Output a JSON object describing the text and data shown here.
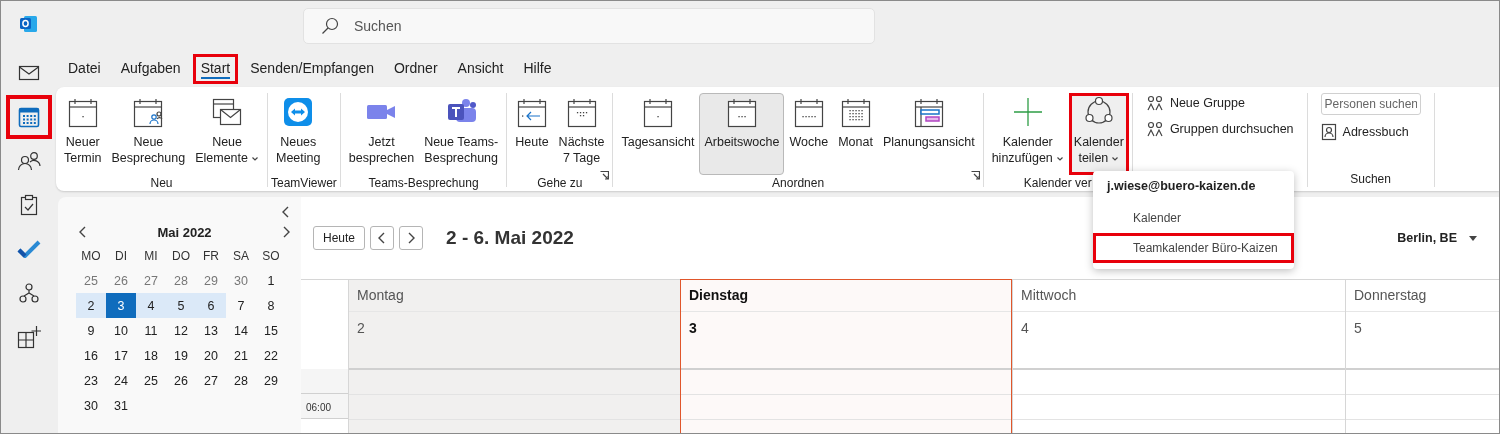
{
  "search": {
    "placeholder": "Suchen"
  },
  "rail": [
    {
      "selected": false,
      "highlighted": false
    },
    {
      "selected": true,
      "highlighted": true
    },
    {
      "selected": false,
      "highlighted": false
    },
    {
      "selected": false,
      "highlighted": false
    },
    {
      "selected": false,
      "highlighted": false
    },
    {
      "selected": false,
      "highlighted": false
    },
    {
      "selected": false,
      "highlighted": false
    }
  ],
  "tabs": [
    {
      "label": "Datei",
      "selected": false,
      "highlighted": false
    },
    {
      "label": "Aufgaben",
      "selected": false,
      "highlighted": false
    },
    {
      "label": "Start",
      "selected": true,
      "highlighted": true
    },
    {
      "label": "Senden/Empfangen",
      "selected": false,
      "highlighted": false
    },
    {
      "label": "Ordner",
      "selected": false,
      "highlighted": false
    },
    {
      "label": "Ansicht",
      "selected": false,
      "highlighted": false
    },
    {
      "label": "Hilfe",
      "selected": false,
      "highlighted": false
    }
  ],
  "ribbon": {
    "groups": [
      {
        "label": "Neu",
        "buttons": [
          {
            "kind": "large",
            "label": "Neuer\nTermin",
            "selected": false,
            "highlighted": false
          },
          {
            "kind": "large",
            "label": "Neue\nBesprechung",
            "selected": false,
            "highlighted": false
          },
          {
            "kind": "large",
            "label": "Neue\nElemente",
            "dropdown": true,
            "selected": false,
            "highlighted": false
          }
        ]
      },
      {
        "label": "TeamViewer",
        "buttons": [
          {
            "kind": "large",
            "label": "Neues\nMeeting",
            "selected": false,
            "highlighted": false
          }
        ]
      },
      {
        "label": "Teams-Besprechung",
        "buttons": [
          {
            "kind": "large",
            "label": "Jetzt\nbesprechen",
            "selected": false,
            "highlighted": false
          },
          {
            "kind": "large",
            "label": "Neue Teams-\nBesprechung",
            "selected": false,
            "highlighted": false
          }
        ]
      },
      {
        "label": "Gehe zu",
        "launcher": true,
        "buttons": [
          {
            "kind": "large",
            "label": "Heute",
            "selected": false,
            "highlighted": false
          },
          {
            "kind": "large",
            "label": "Nächste\n7 Tage",
            "selected": false,
            "highlighted": false
          }
        ]
      },
      {
        "label": "Anordnen",
        "launcher": true,
        "buttons": [
          {
            "kind": "large",
            "label": "Tagesansicht",
            "selected": false,
            "highlighted": false
          },
          {
            "kind": "large",
            "label": "Arbeitswoche",
            "selected": true,
            "highlighted": false
          },
          {
            "kind": "large",
            "label": "Woche",
            "selected": false,
            "highlighted": false
          },
          {
            "kind": "large",
            "label": "Monat",
            "selected": false,
            "highlighted": false
          },
          {
            "kind": "large",
            "label": "Planungsansicht",
            "selected": false,
            "highlighted": false
          }
        ]
      },
      {
        "label": "Kalender ver",
        "buttons": [
          {
            "kind": "large",
            "label": "Kalender\nhinzufügen",
            "dropdown": true,
            "selected": false,
            "highlighted": false
          },
          {
            "kind": "large",
            "label": "Kalender\nteilen",
            "dropdown": true,
            "selected": false,
            "highlighted": true
          }
        ]
      },
      {
        "buttons": [
          {
            "kind": "small",
            "label": "Neue Gruppe"
          },
          {
            "kind": "small",
            "label": "Gruppen durchsuchen"
          }
        ]
      },
      {
        "label": "Suchen",
        "buttons": [
          {
            "kind": "field",
            "placeholder": "Personen suchen"
          },
          {
            "kind": "small",
            "label": "Adressbuch"
          }
        ]
      }
    ]
  },
  "share_menu": {
    "header": "j.wiese@buero-kaizen.de",
    "items": [
      {
        "label": "Kalender",
        "highlighted": false
      },
      {
        "label": "Teamkalender Büro-Kaizen",
        "highlighted": true
      }
    ]
  },
  "mini_calendar": {
    "title": "Mai 2022",
    "weekdays": [
      "MO",
      "DI",
      "MI",
      "DO",
      "FR",
      "SA",
      "SO"
    ],
    "weeks": [
      [
        {
          "day": "25",
          "muted": true,
          "in_range": false,
          "selected": false
        },
        {
          "day": "26",
          "muted": true,
          "in_range": false,
          "selected": false
        },
        {
          "day": "27",
          "muted": true,
          "in_range": false,
          "selected": false
        },
        {
          "day": "28",
          "muted": true,
          "in_range": false,
          "selected": false
        },
        {
          "day": "29",
          "muted": true,
          "in_range": false,
          "selected": false
        },
        {
          "day": "30",
          "muted": true,
          "in_range": false,
          "selected": false
        },
        {
          "day": "1",
          "muted": false,
          "in_range": false,
          "selected": false
        }
      ],
      [
        {
          "day": "2",
          "muted": false,
          "in_range": true,
          "selected": false
        },
        {
          "day": "3",
          "muted": false,
          "in_range": true,
          "selected": true
        },
        {
          "day": "4",
          "muted": false,
          "in_range": true,
          "selected": false
        },
        {
          "day": "5",
          "muted": false,
          "in_range": true,
          "selected": false
        },
        {
          "day": "6",
          "muted": false,
          "in_range": true,
          "selected": false
        },
        {
          "day": "7",
          "muted": false,
          "in_range": false,
          "selected": false
        },
        {
          "day": "8",
          "muted": false,
          "in_range": false,
          "selected": false
        }
      ],
      [
        {
          "day": "9",
          "muted": false,
          "in_range": false,
          "selected": false
        },
        {
          "day": "10",
          "muted": false,
          "in_range": false,
          "selected": false
        },
        {
          "day": "11",
          "muted": false,
          "in_range": false,
          "selected": false
        },
        {
          "day": "12",
          "muted": false,
          "in_range": false,
          "selected": false
        },
        {
          "day": "13",
          "muted": false,
          "in_range": false,
          "selected": false
        },
        {
          "day": "14",
          "muted": false,
          "in_range": false,
          "selected": false
        },
        {
          "day": "15",
          "muted": false,
          "in_range": false,
          "selected": false
        }
      ],
      [
        {
          "day": "16",
          "muted": false,
          "in_range": false,
          "selected": false
        },
        {
          "day": "17",
          "muted": false,
          "in_range": false,
          "selected": false
        },
        {
          "day": "18",
          "muted": false,
          "in_range": false,
          "selected": false
        },
        {
          "day": "19",
          "muted": false,
          "in_range": false,
          "selected": false
        },
        {
          "day": "20",
          "muted": false,
          "in_range": false,
          "selected": false
        },
        {
          "day": "21",
          "muted": false,
          "in_range": false,
          "selected": false
        },
        {
          "day": "22",
          "muted": false,
          "in_range": false,
          "selected": false
        }
      ],
      [
        {
          "day": "23",
          "muted": false,
          "in_range": false,
          "selected": false
        },
        {
          "day": "24",
          "muted": false,
          "in_range": false,
          "selected": false
        },
        {
          "day": "25",
          "muted": false,
          "in_range": false,
          "selected": false
        },
        {
          "day": "26",
          "muted": false,
          "in_range": false,
          "selected": false
        },
        {
          "day": "27",
          "muted": false,
          "in_range": false,
          "selected": false
        },
        {
          "day": "28",
          "muted": false,
          "in_range": false,
          "selected": false
        },
        {
          "day": "29",
          "muted": false,
          "in_range": false,
          "selected": false
        }
      ],
      [
        {
          "day": "30",
          "muted": false,
          "in_range": false,
          "selected": false
        },
        {
          "day": "31",
          "muted": false,
          "in_range": false,
          "selected": false
        }
      ]
    ]
  },
  "calendar": {
    "today_button": "Heute",
    "title": "2 - 6. Mai 2022",
    "location": "Berlin, BE",
    "days": [
      {
        "name": "Montag",
        "date": "2",
        "today": false,
        "shaded": true
      },
      {
        "name": "Dienstag",
        "date": "3",
        "today": true,
        "shaded": false
      },
      {
        "name": "Mittwoch",
        "date": "4",
        "today": false,
        "shaded": false
      },
      {
        "name": "Donnerstag",
        "date": "5",
        "today": false,
        "shaded": false
      }
    ],
    "times": [
      "06:00"
    ]
  }
}
